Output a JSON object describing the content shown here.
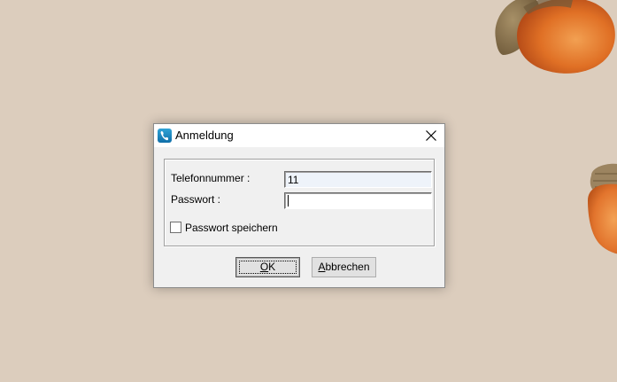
{
  "dialog": {
    "title": "Anmeldung",
    "icon": "telephone-handset-icon",
    "close_icon": "close-icon"
  },
  "form": {
    "phone_label": "Telefonnummer :",
    "phone_value": "11",
    "password_label": "Passwort :",
    "password_value": "",
    "remember_label": "Passwort speichern",
    "remember_checked": false
  },
  "buttons": {
    "ok_mnemonic": "O",
    "ok_rest": "K",
    "cancel_mnemonic": "A",
    "cancel_rest": "bbrechen"
  },
  "colors": {
    "desktop": "#dccdbd",
    "dialog": "#f0f0f0",
    "titlebar": "#ffffff",
    "acorn": "#e2742d"
  }
}
